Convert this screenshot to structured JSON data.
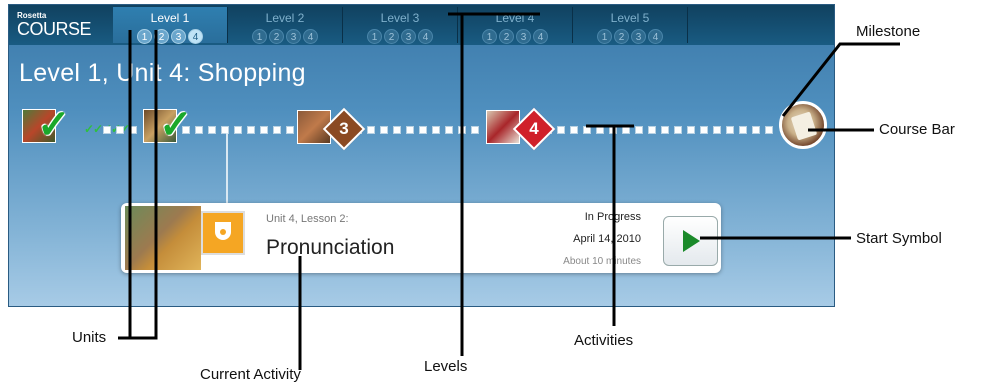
{
  "brand": {
    "small": "Rosetta",
    "big": "COURSE"
  },
  "levels": [
    {
      "label": "Level 1",
      "units": [
        "1",
        "2",
        "3",
        "4"
      ],
      "active": true
    },
    {
      "label": "Level 2",
      "units": [
        "1",
        "2",
        "3",
        "4"
      ],
      "active": false
    },
    {
      "label": "Level 3",
      "units": [
        "1",
        "2",
        "3",
        "4"
      ],
      "active": false
    },
    {
      "label": "Level 4",
      "units": [
        "1",
        "2",
        "3",
        "4"
      ],
      "active": false
    },
    {
      "label": "Level 5",
      "units": [
        "1",
        "2",
        "3",
        "4"
      ],
      "active": false
    }
  ],
  "unit_title": "Level 1, Unit 4: Shopping",
  "course_bar": {
    "badges": [
      "3",
      "4"
    ]
  },
  "current_activity": {
    "lesson": "Unit 4, Lesson 2:",
    "name": "Pronunciation",
    "status": "In Progress",
    "date": "April 14, 2010",
    "duration": "About 10 minutes"
  },
  "callouts": {
    "milestone": "Milestone",
    "course_bar": "Course Bar",
    "start_symbol": "Start Symbol",
    "units": "Units",
    "current_activity": "Current Activity",
    "levels": "Levels",
    "activities": "Activities"
  },
  "colors": {
    "check": "#1ba82a",
    "badge_unit3": "#8b4a22",
    "badge_unit4": "#d0202a",
    "accent": "#1f6590"
  }
}
